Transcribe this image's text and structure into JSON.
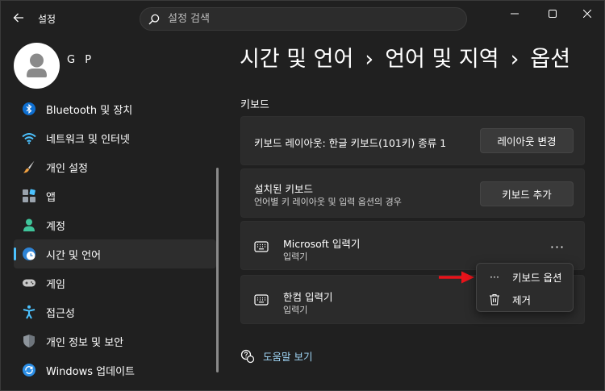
{
  "app": {
    "title": "설정",
    "search_placeholder": "설정 검색"
  },
  "user": {
    "name": "G P"
  },
  "sidebar": {
    "items": [
      {
        "label": "Bluetooth 및 장치",
        "icon": "bluetooth-icon"
      },
      {
        "label": "네트워크 및 인터넷",
        "icon": "wifi-icon"
      },
      {
        "label": "개인 설정",
        "icon": "brush-icon"
      },
      {
        "label": "앱",
        "icon": "apps-icon"
      },
      {
        "label": "계정",
        "icon": "account-icon"
      },
      {
        "label": "시간 및 언어",
        "icon": "time-language-icon",
        "active": true
      },
      {
        "label": "게임",
        "icon": "gamepad-icon"
      },
      {
        "label": "접근성",
        "icon": "accessibility-icon"
      },
      {
        "label": "개인 정보 및 보안",
        "icon": "shield-icon"
      },
      {
        "label": "Windows 업데이트",
        "icon": "update-icon"
      }
    ]
  },
  "breadcrumb": {
    "level1": "시간 및 언어",
    "level2": "언어 및 지역",
    "level3": "옵션",
    "separator": "›"
  },
  "main": {
    "section_title": "키보드",
    "layout_card": {
      "label": "키보드 레이아웃: 한글 키보드(101키) 종류 1",
      "button": "레이아웃 변경"
    },
    "installed_card": {
      "title": "설치된 키보드",
      "subtitle": "언어별 키 레이아웃 및 입력 옵션의 경우",
      "button": "키보드 추가"
    },
    "keyboards": [
      {
        "name": "Microsoft 입력기",
        "type": "입력기"
      },
      {
        "name": "한컴 입력기",
        "type": "입력기"
      }
    ],
    "more_glyph": "···",
    "help_link": "도움말 보기"
  },
  "context_menu": {
    "items": [
      {
        "label": "키보드 옵션",
        "glyph": "···"
      },
      {
        "label": "제거"
      }
    ]
  },
  "colors": {
    "background": "#202020",
    "card": "#2b2b2b",
    "accent": "#4cc2ff",
    "arrow": "#e8131a",
    "link": "#9fd5f5"
  }
}
